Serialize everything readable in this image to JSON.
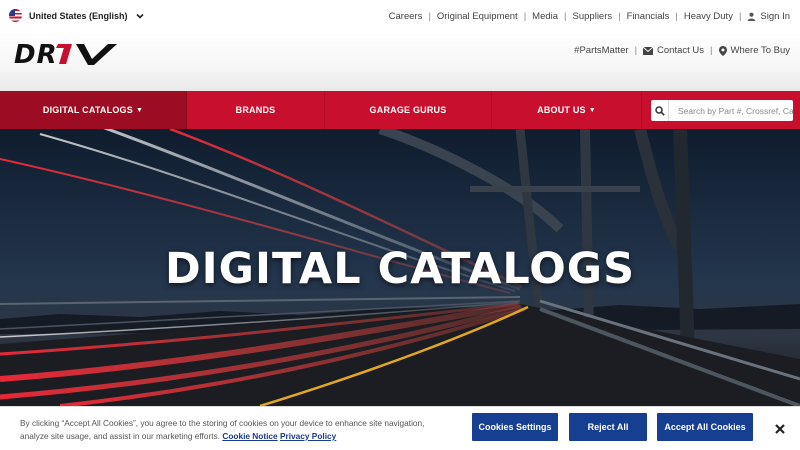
{
  "locale": {
    "label": "United States (English)"
  },
  "utility_nav": {
    "items": [
      "Careers",
      "Original Equipment",
      "Media",
      "Suppliers",
      "Financials",
      "Heavy Duty"
    ],
    "sign_in": "Sign In"
  },
  "brand": {
    "logo_text": "DRiV"
  },
  "sub_nav": {
    "hashtag": "#PartsMatter",
    "contact": "Contact Us",
    "where_to_buy": "Where To Buy"
  },
  "main_nav": {
    "items": [
      {
        "label": "DIGITAL CATALOGS",
        "dropdown": true
      },
      {
        "label": "BRANDS",
        "dropdown": false
      },
      {
        "label": "GARAGE GURUS",
        "dropdown": false
      },
      {
        "label": "ABOUT US",
        "dropdown": true
      }
    ],
    "search_placeholder": "Search by Part #, Crossref, Category..."
  },
  "hero": {
    "title": "DIGITAL CATALOGS"
  },
  "cookie_banner": {
    "text": "By clicking “Accept All Cookies”, you agree to the storing of cookies on your device to enhance site navigation, analyze site usage, and assist in our marketing efforts.",
    "cookie_notice": "Cookie Notice",
    "privacy_policy": "Privacy Policy",
    "settings_label": "Cookies Settings",
    "reject_label": "Reject All",
    "accept_label": "Accept All Cookies"
  },
  "colors": {
    "brand_red": "#c8102e",
    "active_red": "#9c0c22",
    "cookie_blue": "#163f91"
  },
  "icons": [
    "us-flag-icon",
    "chevron-down-icon",
    "user-icon",
    "envelope-icon",
    "map-pin-icon",
    "search-icon",
    "close-icon"
  ]
}
